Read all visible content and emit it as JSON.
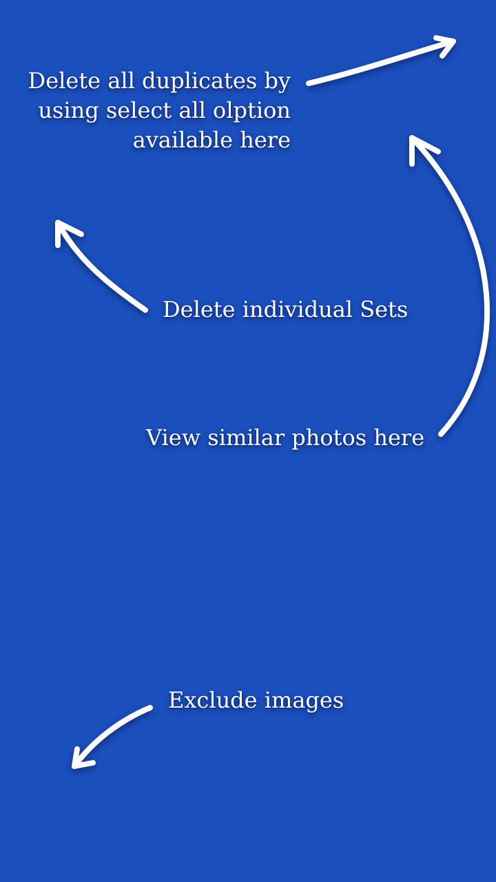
{
  "screen": {
    "background_color": "#1b4fbe",
    "text_color": "#ffffff"
  },
  "hints": {
    "select_all": {
      "lines": [
        "Delete all duplicates by",
        "using select all olption",
        "available here"
      ]
    },
    "delete_sets": {
      "label": "Delete individual Sets"
    },
    "view_similar": {
      "label": "View similar photos here"
    },
    "exclude": {
      "label": "Exclude images"
    }
  },
  "icons": {
    "select_all_arrow": "arrow-up-right-icon",
    "delete_sets_arrow": "arrow-up-left-icon",
    "view_similar_arrow": "arrow-curved-up-icon",
    "exclude_arrow": "arrow-down-left-icon"
  }
}
